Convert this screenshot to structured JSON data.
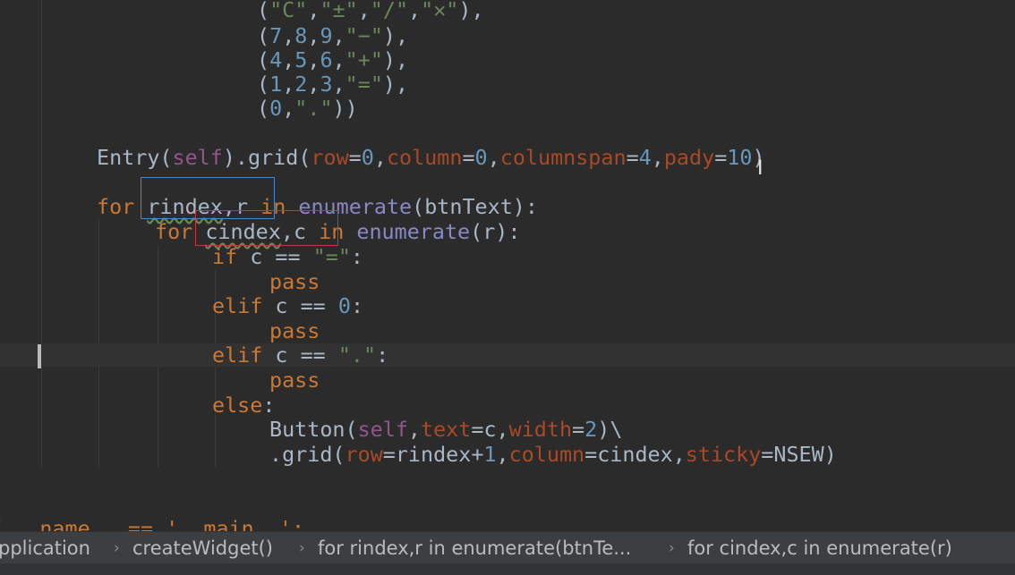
{
  "code_lines": {
    "l1": {
      "open": "(",
      "q1": "\"C\"",
      "c1": ",",
      "q2": "\"±\"",
      "c2": ",",
      "q3": "\"/\"",
      "c3": ",",
      "q4": "\"✕\"",
      "close": "),"
    },
    "l2": {
      "open": "(",
      "n1": "7",
      "c1": ",",
      "n2": "8",
      "c2": ",",
      "n3": "9",
      "c3": ",",
      "s": "\"−\"",
      "close": "),"
    },
    "l3": {
      "open": "(",
      "n1": "4",
      "c1": ",",
      "n2": "5",
      "c2": ",",
      "n3": "6",
      "c3": ",",
      "s": "\"+\"",
      "close": "),"
    },
    "l4": {
      "open": "(",
      "n1": "1",
      "c1": ",",
      "n2": "2",
      "c2": ",",
      "n3": "3",
      "c3": ",",
      "s": "\"=\"",
      "close": "),"
    },
    "l5": {
      "open": "(",
      "n1": "0",
      "c1": ",",
      "s": "\".\"",
      "close": "))"
    },
    "l6": {
      "a": "Entry(",
      "self": "self",
      "b": ").grid(",
      "p1": "row",
      "eq1": "=",
      "v1": "0",
      "c1": ",",
      "p2": "column",
      "eq2": "=",
      "v2": "0",
      "c2": ",",
      "p3": "columnspan",
      "eq3": "=",
      "v3": "4",
      "c3": ",",
      "p4": "pady",
      "eq4": "=",
      "v4": "10",
      "close": ")"
    },
    "l7": {
      "for": "for",
      "sp1": " ",
      "var1": "rindex",
      "c1": ",",
      "var2": "r",
      "sp2": " ",
      "in": "in",
      "sp3": " ",
      "fn": "enumerate",
      "rest": "(btnText):"
    },
    "l8": {
      "for": "for",
      "sp1": " ",
      "var1": "cindex",
      "c1": ",",
      "var2": "c",
      "sp2": " ",
      "in": "in",
      "sp3": " ",
      "fn": "enumerate",
      "rest": "(r):"
    },
    "l9": {
      "if": "if",
      "mid": " c == ",
      "s": "\"=\"",
      "end": ":"
    },
    "l10": {
      "pass": "pass"
    },
    "l11": {
      "elif": "elif",
      "mid": " c == ",
      "n": "0",
      "end": ":"
    },
    "l12": {
      "pass": "pass"
    },
    "l13": {
      "elif": "elif",
      "mid": " c == ",
      "s": "\".\"",
      "end": ":"
    },
    "l14": {
      "pass": "pass"
    },
    "l15": {
      "else": "else",
      "end": ":"
    },
    "l16": {
      "a": "Button(",
      "self": "self",
      "c1": ",",
      "p1": "text",
      "eq1": "=c",
      "c2": ",",
      "p2": "width",
      "eq2": "=",
      "v2": "2",
      "end": ")\\"
    },
    "l17": {
      "a": ".grid(",
      "p1": "row",
      "eq1": "=rindex+",
      "v1": "1",
      "c1": ",",
      "p2": "column",
      "eq2": "=cindex",
      "c2": ",",
      "p3": "sticky",
      "eq3": "=NSEW)"
    },
    "l18": {
      "text": "f __name__ == '__main__':"
    }
  },
  "breadcrumbs": {
    "items": [
      "pplication",
      "createWidget()",
      "for rindex,r in enumerate(btnTe...",
      "for cindex,c in enumerate(r)"
    ],
    "separator": "›"
  },
  "colors": {
    "background": "#2b2b2b",
    "keyword": "#cc7832",
    "self": "#94558d",
    "number": "#6897bb",
    "string": "#6a8759",
    "parameter": "#aa4926",
    "identifier": "#a9b7c6",
    "highlight_box_blue": "#4a88c7",
    "highlight_box_red": "#c8373a"
  },
  "icons": {
    "cursor": "text-cursor-icon"
  }
}
